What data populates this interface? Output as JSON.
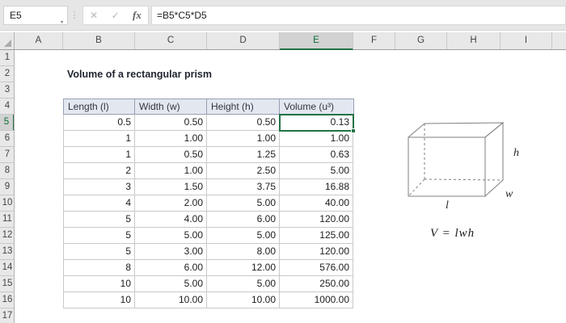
{
  "formula_bar": {
    "name_box_value": "E5",
    "formula": "=B5*C5*D5",
    "icons": {
      "dropdown": "▾",
      "separator_dots": "⋮",
      "cancel": "✕",
      "enter": "✓",
      "fx": "fx"
    }
  },
  "grid": {
    "column_headers": [
      "A",
      "B",
      "C",
      "D",
      "E",
      "F",
      "G",
      "H",
      "I"
    ],
    "selected_column": "E",
    "row_headers": [
      "1",
      "2",
      "3",
      "4",
      "5",
      "6",
      "7",
      "8",
      "9",
      "10",
      "11",
      "12",
      "13",
      "14",
      "15",
      "16",
      "17"
    ],
    "selected_row": "5"
  },
  "sheet": {
    "title": "Volume of a rectangular prism",
    "table": {
      "headers": [
        "Length (l)",
        "Width (w)",
        "Height (h)",
        "Volume (u³)"
      ],
      "rows": [
        [
          "0.5",
          "0.50",
          "0.50",
          "0.13"
        ],
        [
          "1",
          "1.00",
          "1.00",
          "1.00"
        ],
        [
          "1",
          "0.50",
          "1.25",
          "0.63"
        ],
        [
          "2",
          "1.00",
          "2.50",
          "5.00"
        ],
        [
          "3",
          "1.50",
          "3.75",
          "16.88"
        ],
        [
          "4",
          "2.00",
          "5.00",
          "40.00"
        ],
        [
          "5",
          "4.00",
          "6.00",
          "120.00"
        ],
        [
          "5",
          "5.00",
          "5.00",
          "125.00"
        ],
        [
          "5",
          "3.00",
          "8.00",
          "120.00"
        ],
        [
          "8",
          "6.00",
          "12.00",
          "576.00"
        ],
        [
          "10",
          "5.00",
          "5.00",
          "250.00"
        ],
        [
          "10",
          "10.00",
          "10.00",
          "1000.00"
        ]
      ]
    },
    "diagram": {
      "label_height": "h",
      "label_width": "w",
      "label_length": "l",
      "formula": "V = lwh"
    }
  },
  "colors": {
    "accent_green": "#217346",
    "toolbar_gray": "#e6e6e6",
    "header_gray": "#e8e8e8",
    "selected_header_gray": "#d2d2d2",
    "table_header_fill": "#e3e7f0",
    "table_header_border": "#95a0b5",
    "table_grid_border": "#c9c9c9",
    "title_text": "#1f2430"
  }
}
